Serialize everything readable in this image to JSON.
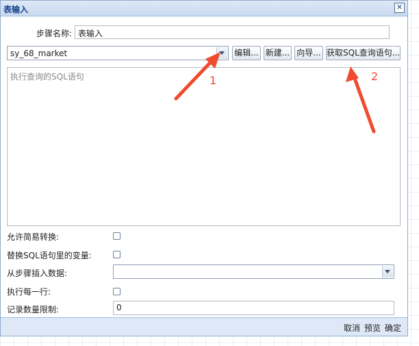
{
  "dialog": {
    "title": "表输入",
    "close_glyph": "✕"
  },
  "step": {
    "label": "步骤名称:",
    "value": "表输入"
  },
  "connection": {
    "value": "sy_68_market",
    "buttons": {
      "edit": "编辑...",
      "new": "新建...",
      "wizard": "向导...",
      "get_sql": "获取SQL查询语句..."
    }
  },
  "sql": {
    "placeholder": "执行查询的SQL语句"
  },
  "options": {
    "lazy_conversion_label": "允许简易转换:",
    "replace_vars_label": "替换SQL语句里的变量:",
    "insert_from_step_label": "从步骤插入数据:",
    "insert_from_step_value": "",
    "execute_each_row_label": "执行每一行:",
    "limit_label": "记录数量限制:",
    "limit_value": "0"
  },
  "footer": {
    "cancel": "取消",
    "preview": "预览",
    "ok": "确定"
  },
  "annotations": {
    "label_1": "1",
    "label_2": "2",
    "color": "#f04a2f"
  }
}
